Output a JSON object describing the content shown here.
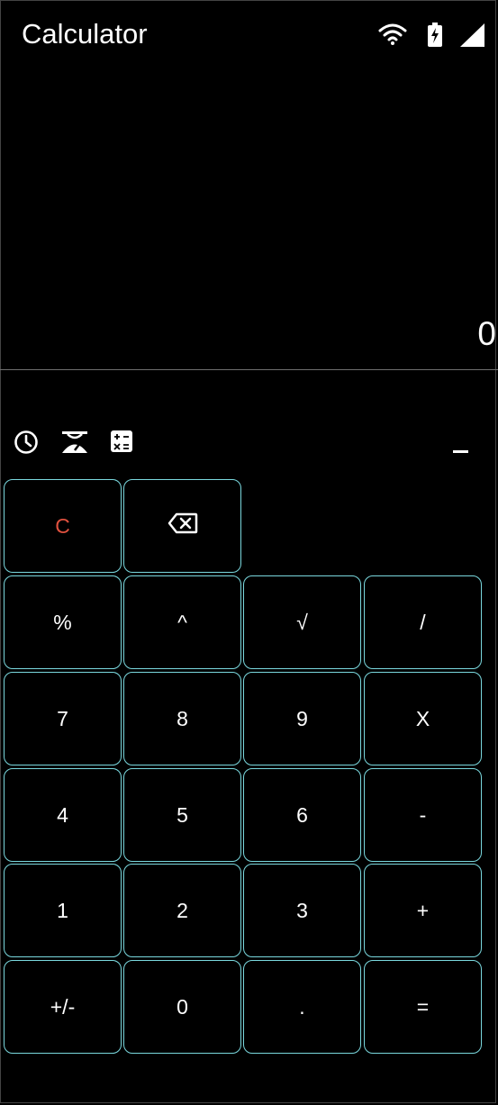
{
  "app": {
    "title": "Calculator"
  },
  "status": {
    "wifi_icon": "wifi-icon",
    "battery_icon": "battery-charging-icon",
    "signal_icon": "cell-signal-icon"
  },
  "display": {
    "value": "0"
  },
  "toolbar": {
    "history_icon": "history-icon",
    "converter_icon": "unit-converter-icon",
    "scientific_icon": "calculator-mode-icon",
    "collapse_icon": "collapse-icon"
  },
  "keys": {
    "clear": "C",
    "backspace_icon": "backspace-icon",
    "percent": "%",
    "power": "^",
    "sqrt": "√",
    "divide": "/",
    "seven": "7",
    "eight": "8",
    "nine": "9",
    "multiply": "X",
    "four": "4",
    "five": "5",
    "six": "6",
    "minus": "-",
    "one": "1",
    "two": "2",
    "three": "3",
    "plus": "+",
    "sign": "+/-",
    "zero": "0",
    "decimal": ".",
    "equals": "="
  },
  "colors": {
    "background": "#000000",
    "key_border": "#7ad8de",
    "clear_text": "#e0513f",
    "text": "#ffffff"
  }
}
